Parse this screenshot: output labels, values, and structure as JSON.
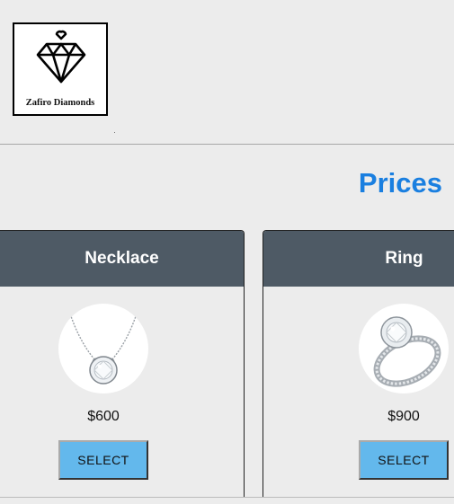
{
  "logo": {
    "brand_name": "Zafiro Diamonds",
    "icon": "diamond-logo-icon"
  },
  "section": {
    "title": "Prices"
  },
  "products": [
    {
      "name": "Necklace",
      "price": "$600",
      "button_label": "SELECT",
      "image": "necklace-image"
    },
    {
      "name": "Ring",
      "price": "$900",
      "button_label": "SELECT",
      "image": "ring-image"
    }
  ],
  "colors": {
    "accent_blue": "#1a7fe0",
    "card_header": "#4e5a65",
    "button_bg": "#63b8ec",
    "page_bg": "#ececec"
  }
}
